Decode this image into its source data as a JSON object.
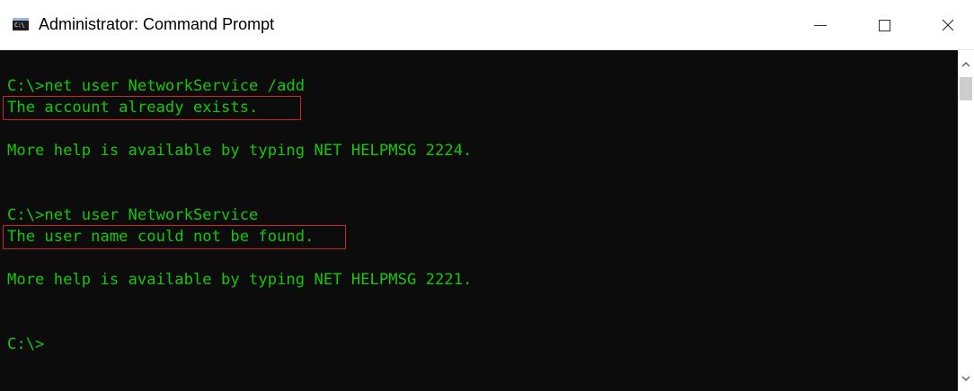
{
  "window": {
    "title": "Administrator: Command Prompt",
    "app_icon_glyph": "C:\\"
  },
  "console": {
    "lines": [
      "C:\\>net user NetworkService /add",
      "The account already exists.",
      "",
      "More help is available by typing NET HELPMSG 2224.",
      "",
      "",
      "C:\\>net user NetworkService",
      "The user name could not be found.",
      "",
      "More help is available by typing NET HELPMSG 2221.",
      "",
      "",
      "C:\\>"
    ],
    "text_color": "#16c60c",
    "background_color": "#0c0c0c",
    "highlight_color": "#c42b1c"
  },
  "icons": {
    "app": "cmd-icon",
    "minimize": "minimize-icon",
    "maximize": "maximize-icon",
    "close": "close-icon",
    "scroll_up": "chevron-up-icon",
    "scroll_down": "chevron-down-icon"
  }
}
